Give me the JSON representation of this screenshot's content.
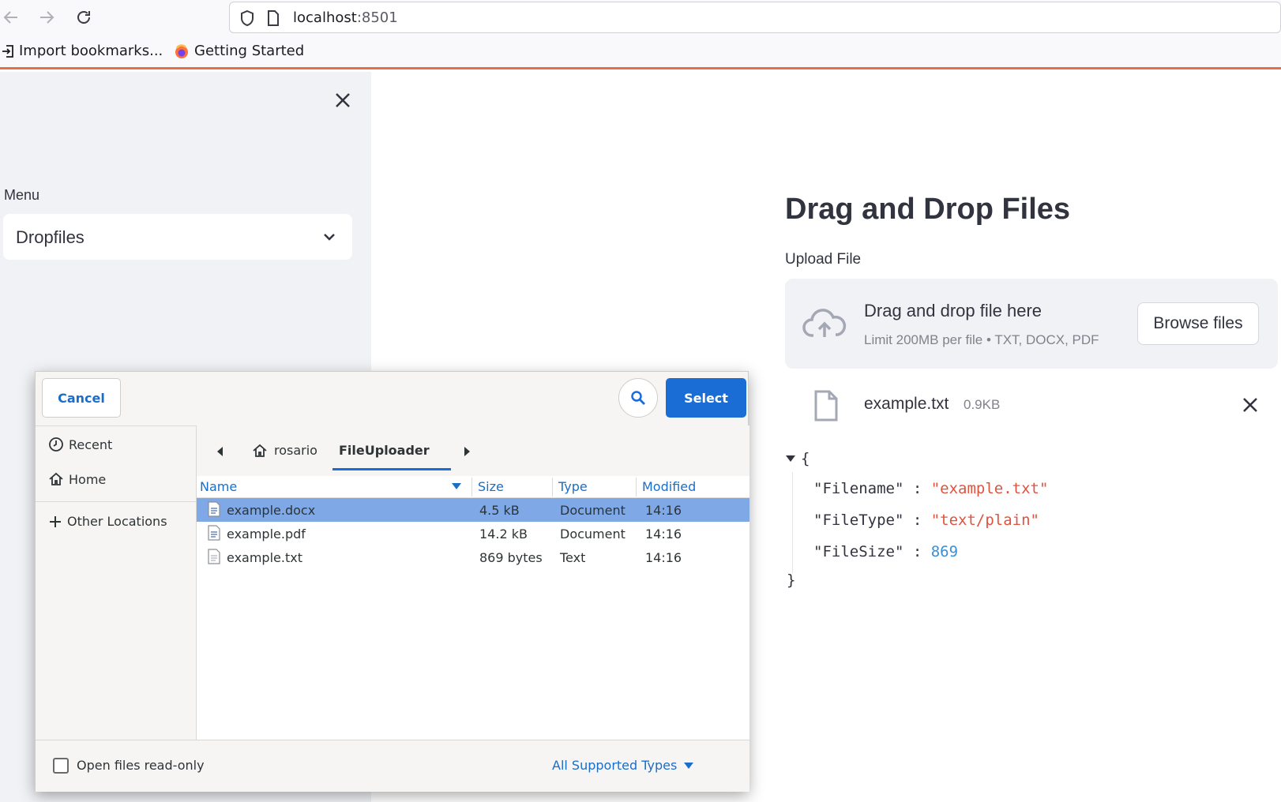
{
  "browser": {
    "url_host": "localhost",
    "url_port": ":8501",
    "bookmarks": [
      {
        "label": "Import bookmarks...",
        "icon": "import-icon"
      },
      {
        "label": "Getting Started",
        "icon": "firefox-icon"
      }
    ],
    "accent_color": "#e66f4b"
  },
  "sidebar": {
    "menu_label": "Menu",
    "menu_value": "Dropfiles"
  },
  "main": {
    "title": "Drag and Drop Files",
    "upload_label": "Upload File",
    "dropzone": {
      "title": "Drag and drop file here",
      "limit": "Limit 200MB per file • TXT, DOCX, PDF",
      "browse_label": "Browse files"
    },
    "uploaded_file": {
      "name": "example.txt",
      "size": "0.9KB"
    },
    "json_view": {
      "open_brace": "{",
      "close_brace": "}",
      "entries": [
        {
          "key": "\"Filename\"",
          "sep": " : ",
          "value": "\"example.txt\"",
          "kind": "string"
        },
        {
          "key": "\"FileType\"",
          "sep": " : ",
          "value": "\"text/plain\"",
          "kind": "string"
        },
        {
          "key": "\"FileSize\"",
          "sep": " : ",
          "value": "869",
          "kind": "number"
        }
      ]
    }
  },
  "dialog": {
    "cancel_label": "Cancel",
    "select_label": "Select",
    "places": [
      {
        "label": "Recent",
        "icon": "clock-icon"
      },
      {
        "label": "Home",
        "icon": "home-icon"
      },
      {
        "label": "Other Locations",
        "icon": "plus-icon"
      }
    ],
    "path": {
      "parent": "rosario",
      "current": "FileUploader"
    },
    "columns": [
      "Name",
      "Size",
      "Type",
      "Modified"
    ],
    "files": [
      {
        "name": "example.docx",
        "size": "4.5 kB",
        "type": "Document",
        "modified": "14:16",
        "selected": true
      },
      {
        "name": "example.pdf",
        "size": "14.2 kB",
        "type": "Document",
        "modified": "14:16",
        "selected": false
      },
      {
        "name": "example.txt",
        "size": "869 bytes",
        "type": "Text",
        "modified": "14:16",
        "selected": false
      }
    ],
    "readonly_label": "Open files read-only",
    "filter_label": "All Supported Types",
    "accent_color": "#1b6dd6"
  }
}
